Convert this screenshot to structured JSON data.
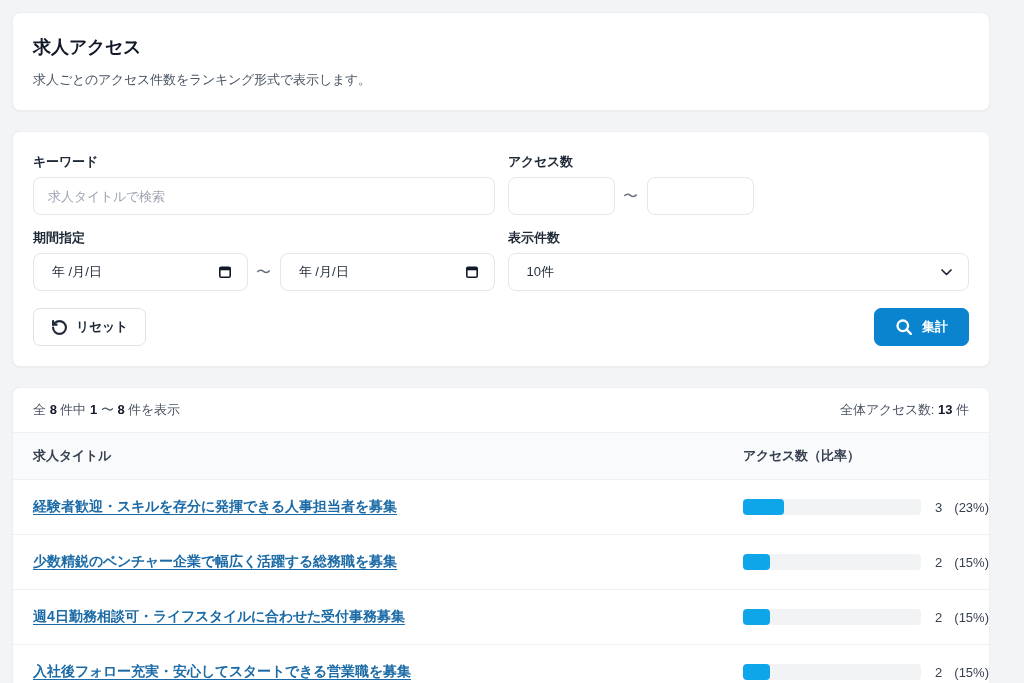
{
  "page_header": {
    "title": "求人アクセス",
    "description": "求人ごとのアクセス件数をランキング形式で表示します。"
  },
  "filters": {
    "keyword": {
      "label": "キーワード",
      "placeholder": "求人タイトルで検索"
    },
    "access_count": {
      "label": "アクセス数",
      "separator": "〜"
    },
    "period": {
      "label": "期間指定",
      "from": {
        "placeholder": "年 /月/日"
      },
      "separator": "〜",
      "to": {
        "placeholder": "年 /月/日"
      }
    },
    "page_size": {
      "label": "表示件数",
      "value": "10件"
    },
    "buttons": [
      {
        "kind": "reset",
        "label": "リセット"
      },
      {
        "kind": "search",
        "label": "集計"
      }
    ]
  },
  "results": {
    "summary": "全 **8** 件中 **1** 〜 **8** 件を表示",
    "total": "全体アクセス数: **13** 件",
    "columns": [
      "求人タイトル",
      "アクセス数（比率）"
    ],
    "rows": [
      {
        "title": "経験者歓迎・スキルを存分に発揮できる人事担当者を募集",
        "level": 0.23,
        "count": "3",
        "ratio": "(23%)"
      },
      {
        "title": "少数精鋭のベンチャー企業で幅広く活躍する総務職を募集",
        "level": 0.15,
        "count": "2",
        "ratio": "(15%)"
      },
      {
        "title": "週4日勤務相談可・ライフスタイルに合わせた受付事務募集",
        "level": 0.15,
        "count": "2",
        "ratio": "(15%)"
      },
      {
        "title": "入社後フォロー充実・安心してスタートできる営業職を募集",
        "level": 0.15,
        "count": "2",
        "ratio": "(15%)"
      }
    ]
  }
}
